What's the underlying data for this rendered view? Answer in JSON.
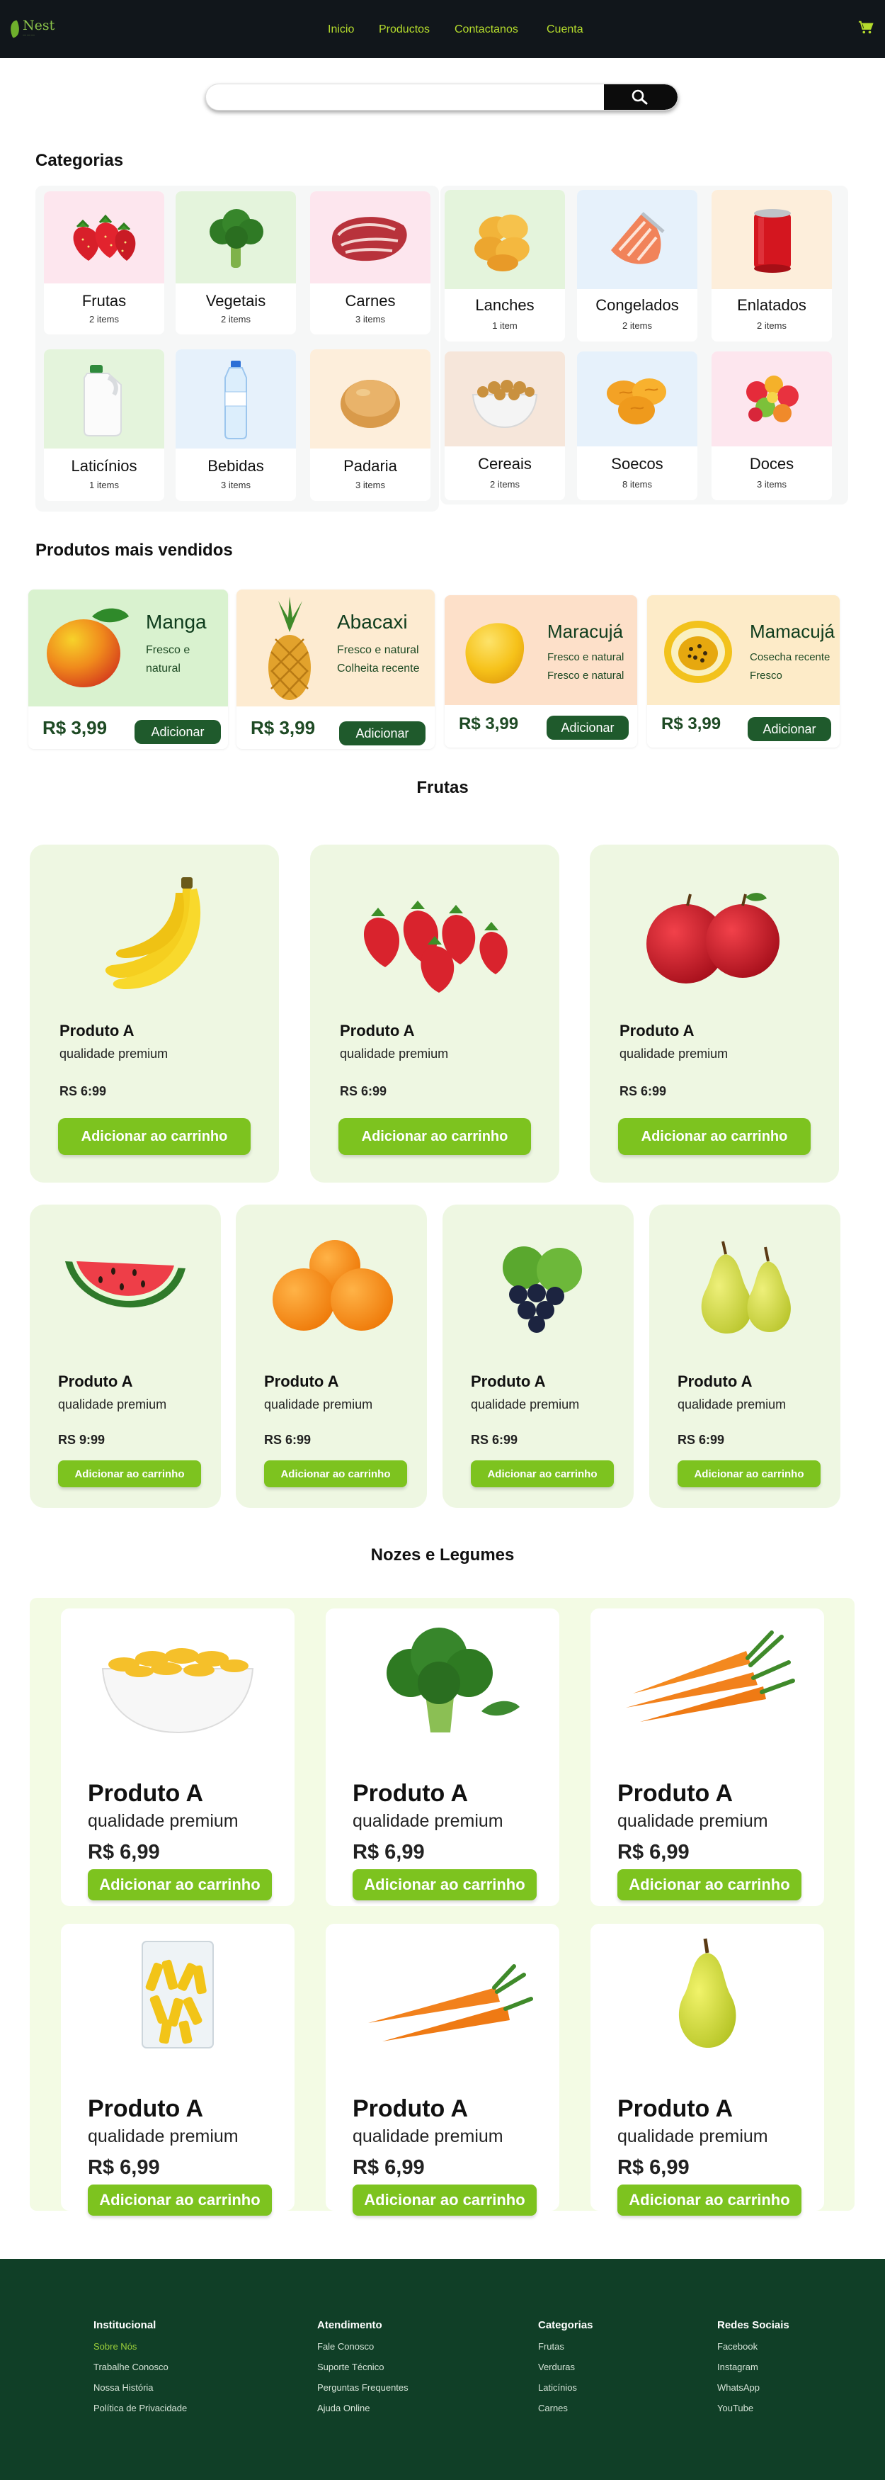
{
  "header": {
    "brand": "Nest",
    "nav": [
      "Inicio",
      "Productos",
      "Contactanos",
      "Cuenta"
    ]
  },
  "search": {
    "placeholder": ""
  },
  "categories": {
    "title": "Categorias",
    "items": [
      {
        "name": "Frutas",
        "count": "2 items",
        "icon": "strawberry-icon",
        "bg": "#fde6ee"
      },
      {
        "name": "Vegetais",
        "count": "2 items",
        "icon": "broccoli-icon",
        "bg": "#e4f4dc"
      },
      {
        "name": "Carnes",
        "count": "3 items",
        "icon": "meat-icon",
        "bg": "#fde6ee"
      },
      {
        "name": "Lanches",
        "count": "1 item",
        "icon": "chips-icon",
        "bg": "#e4f4dc"
      },
      {
        "name": "Congelados",
        "count": "2 items",
        "icon": "salmon-icon",
        "bg": "#e6f1fb"
      },
      {
        "name": "Enlatados",
        "count": "2 items",
        "icon": "can-icon",
        "bg": "#fdeedb"
      },
      {
        "name": "Laticínios",
        "count": "1 items",
        "icon": "milk-icon",
        "bg": "#e4f4dc"
      },
      {
        "name": "Bebidas",
        "count": "3 items",
        "icon": "water-bottle-icon",
        "bg": "#e6f1fb"
      },
      {
        "name": "Padaria",
        "count": "3 items",
        "icon": "bread-icon",
        "bg": "#fdeedb"
      },
      {
        "name": "Cereais",
        "count": "2 items",
        "icon": "cereal-bowl-icon",
        "bg": "#f6e6da"
      },
      {
        "name": "Soecos",
        "count": "8 items",
        "icon": "dried-apricot-icon",
        "bg": "#e6f1fb"
      },
      {
        "name": "Doces",
        "count": "3 items",
        "icon": "gummy-candy-icon",
        "bg": "#fde6ee"
      }
    ]
  },
  "bestsellers": {
    "title": "Produtos mais vendidos",
    "items": [
      {
        "name": "Manga",
        "desc1": "Fresco e",
        "desc2": "natural",
        "price": "R$ 3,99",
        "button": "Adicionar",
        "icon": "mango-icon",
        "bg": "#d9f2cf"
      },
      {
        "name": "Abacaxi",
        "desc1": "Fresco e natural",
        "desc2": "Colheita recente",
        "price": "R$ 3,99",
        "button": "Adicionar",
        "icon": "pineapple-icon",
        "bg": "#fdebd1"
      },
      {
        "name": "Maracujá",
        "desc1": "Fresco e natural",
        "desc2": "Fresco e natural",
        "price": "R$ 3,99",
        "button": "Adicionar",
        "icon": "yellow-mango-icon",
        "bg": "#fde0c9"
      },
      {
        "name": "Mamacujá",
        "desc1": "Cosecha recente",
        "desc2": "Fresco",
        "price": "R$ 3,99",
        "button": "Adicionar",
        "icon": "passion-fruit-icon",
        "bg": "#fdebc8"
      }
    ]
  },
  "fruits": {
    "title": "Frutas",
    "items": [
      {
        "name": "Produto A",
        "quality": "qualidade premium",
        "price": "RS 6:99",
        "button": "Adicionar ao carrinho",
        "icon": "banana-icon"
      },
      {
        "name": "Produto A",
        "quality": "qualidade premium",
        "price": "RS 6:99",
        "button": "Adicionar ao carrinho",
        "icon": "strawberries-icon"
      },
      {
        "name": "Produto A",
        "quality": "qualidade premium",
        "price": "RS 6:99",
        "button": "Adicionar ao carrinho",
        "icon": "apples-icon"
      },
      {
        "name": "Produto A",
        "quality": "qualidade premium",
        "price": "RS 9:99",
        "button": "Adicionar ao carrinho",
        "icon": "watermelon-icon"
      },
      {
        "name": "Produto A",
        "quality": "qualidade premium",
        "price": "RS 6:99",
        "button": "Adicionar ao carrinho",
        "icon": "oranges-icon"
      },
      {
        "name": "Produto A",
        "quality": "qualidade premium",
        "price": "RS 6:99",
        "button": "Adicionar ao carrinho",
        "icon": "grapes-limes-icon"
      },
      {
        "name": "Produto A",
        "quality": "qualidade premium",
        "price": "RS 6:99",
        "button": "Adicionar ao carrinho",
        "icon": "pears-icon"
      }
    ]
  },
  "nuts": {
    "title": "Nozes e Legumes",
    "items": [
      {
        "name": "Produto A",
        "quality": "qualidade premium",
        "price": "R$ 6,99",
        "button": "Adicionar ao carrinho",
        "icon": "corn-flakes-icon"
      },
      {
        "name": "Produto A",
        "quality": "qualidade premium",
        "price": "R$ 6,99",
        "button": "Adicionar ao carrinho",
        "icon": "broccoli-icon"
      },
      {
        "name": "Produto A",
        "quality": "qualidade premium",
        "price": "R$ 6,99",
        "button": "Adicionar ao carrinho",
        "icon": "carrots-icon"
      },
      {
        "name": "Produto A",
        "quality": "qualidade premium",
        "price": "R$ 6,99",
        "button": "Adicionar ao carrinho",
        "icon": "pasta-bag-icon"
      },
      {
        "name": "Produto A",
        "quality": "qualidade premium",
        "price": "R$ 6,99",
        "button": "Adicionar ao carrinho",
        "icon": "carrots-icon"
      },
      {
        "name": "Produto A",
        "quality": "qualidade premium",
        "price": "R$ 6,99",
        "button": "Adicionar ao carrinho",
        "icon": "pear-icon"
      }
    ]
  },
  "footer": {
    "columns": [
      {
        "title": "Institucional",
        "links": [
          "Sobre Nós",
          "Trabalhe Conosco",
          "Nossa História",
          "Política de Privacidade"
        ]
      },
      {
        "title": "Atendimento",
        "links": [
          "Fale Conosco",
          "Suporte Técnico",
          "Perguntas Frequentes",
          "Ajuda Online"
        ]
      },
      {
        "title": "Categorias",
        "links": [
          "Frutas",
          "Verduras",
          "Laticínios",
          "Carnes"
        ]
      },
      {
        "title": "Redes Sociais",
        "links": [
          "Facebook",
          "Instagram",
          "WhatsApp",
          "YouTube"
        ]
      }
    ]
  }
}
